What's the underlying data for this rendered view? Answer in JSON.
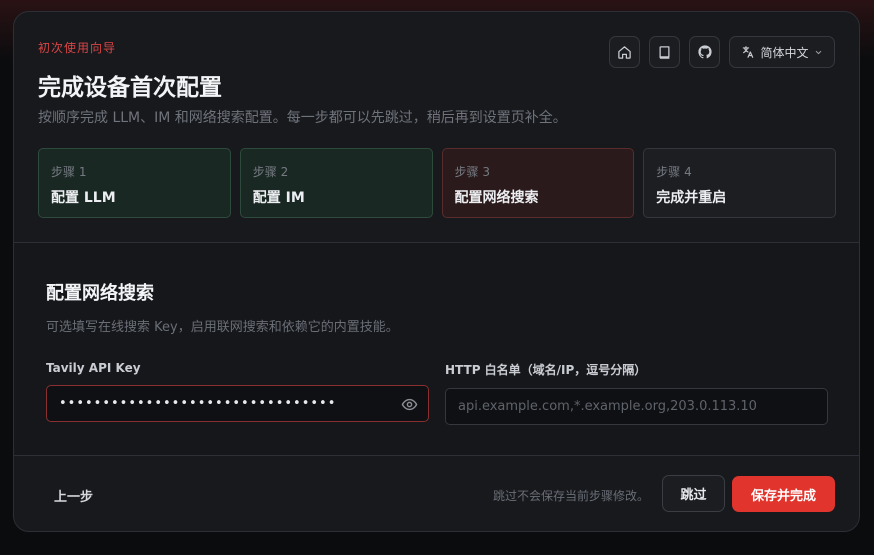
{
  "header": {
    "eyebrow": "初次使用向导",
    "title": "完成设备首次配置",
    "subtitle": "按顺序完成 LLM、IM 和网络搜索配置。每一步都可以先跳过，稍后再到设置页补全。"
  },
  "toolbar": {
    "icons": [
      "home-icon",
      "book-icon",
      "github-icon"
    ],
    "language_icon": "translate-icon",
    "language": "简体中文"
  },
  "steps": [
    {
      "num": "步骤 1",
      "label": "配置 LLM",
      "state": "done"
    },
    {
      "num": "步骤 2",
      "label": "配置 IM",
      "state": "done"
    },
    {
      "num": "步骤 3",
      "label": "配置网络搜索",
      "state": "active"
    },
    {
      "num": "步骤 4",
      "label": "完成并重启",
      "state": "pending"
    }
  ],
  "section": {
    "title": "配置网络搜索",
    "description": "可选填写在线搜索 Key，启用联网搜索和依赖它的内置技能。",
    "tavily": {
      "label": "Tavily API Key",
      "value": "••••••••••••••••••••••••••••••••"
    },
    "whitelist": {
      "label": "HTTP 白名单（域名/IP，逗号分隔）",
      "placeholder": "api.example.com,*.example.org,203.0.113.10",
      "value": ""
    }
  },
  "footer": {
    "back": "上一步",
    "hint": "跳过不会保存当前步骤修改。",
    "skip": "跳过",
    "save": "保存并完成"
  },
  "colors": {
    "accent": "#e1342d",
    "done_bg": "#1a2823",
    "active_bg": "#2a1a1b",
    "error_border": "#8a2f30"
  }
}
